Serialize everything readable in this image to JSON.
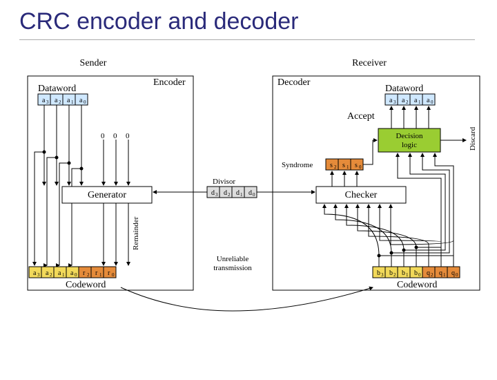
{
  "title": "CRC encoder and decoder",
  "sender_label": "Sender",
  "receiver_label": "Receiver",
  "encoder_label": "Encoder",
  "decoder_label": "Decoder",
  "dataword_label": "Dataword",
  "codeword_label": "Codeword",
  "generator_label": "Generator",
  "checker_label": "Checker",
  "divisor_label": "Divisor",
  "remainder_label": "Remainder",
  "syndrome_label": "Syndrome",
  "decision_label_l1": "Decision",
  "decision_label_l2": "logic",
  "accept_label": "Accept",
  "discard_label": "Discard",
  "transmission_l1": "Unreliable",
  "transmission_l2": "transmission",
  "sender_dataword_bits": [
    "a",
    "a",
    "a",
    "a"
  ],
  "sender_dataword_sub": [
    "3",
    "2",
    "1",
    "0"
  ],
  "sender_codeword_bits": [
    "a",
    "a",
    "a",
    "a",
    "r",
    "r",
    "r"
  ],
  "sender_codeword_sub": [
    "3",
    "2",
    "1",
    "0",
    "2",
    "1",
    "0"
  ],
  "receiver_dataword_bits": [
    "a",
    "a",
    "a",
    "a"
  ],
  "receiver_dataword_sub": [
    "3",
    "2",
    "1",
    "0"
  ],
  "receiver_codeword_bits": [
    "b",
    "b",
    "b",
    "b",
    "q",
    "q",
    "q"
  ],
  "receiver_codeword_sub": [
    "3",
    "2",
    "1",
    "0",
    "2",
    "1",
    "0"
  ],
  "divisor_bits": [
    "d",
    "d",
    "d",
    "d"
  ],
  "divisor_sub": [
    "3",
    "2",
    "1",
    "0"
  ],
  "syndrome_bits": [
    "s",
    "s",
    "s"
  ],
  "syndrome_sub": [
    "2",
    "1",
    "0"
  ],
  "zeros": [
    "0",
    "0",
    "0"
  ]
}
